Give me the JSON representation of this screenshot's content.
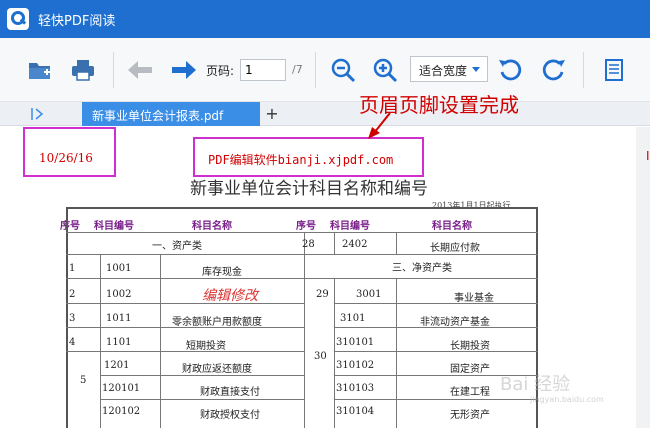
{
  "app": {
    "title": "轻快PDF阅读"
  },
  "toolbar": {
    "page_label": "页码:",
    "page_value": "1",
    "page_total": "/7",
    "zoom_mode": "适合宽度"
  },
  "tabs": [
    {
      "label": "新事业单位会计报表.pdf"
    }
  ],
  "annotation": {
    "callout": "页眉页脚设置完成"
  },
  "document": {
    "header_date": "10/26/16",
    "header_text": "PDF编辑软件bianji.xjpdf.com",
    "title": "新事业单位会计科目名称和编号",
    "effective_date": "2013年1月1日起执行",
    "columns": [
      "序号",
      "科目编号",
      "科目名称",
      "序号",
      "科目编号",
      "科目名称"
    ],
    "rows": {
      "r1": {
        "left_section": "一、资产类",
        "right_no": "28",
        "right_code": "2402",
        "right_name": "长期应付款"
      },
      "r2": {
        "left_no": "1",
        "left_code": "1001",
        "left_name": "库存现金",
        "right_section": "三、净资产类"
      },
      "r3": {
        "left_no": "2",
        "left_code": "1002",
        "left_name": "编辑修改",
        "right_no": "29",
        "right_code": "3001",
        "right_name": "事业基金"
      },
      "r4": {
        "left_no": "3",
        "left_code": "1011",
        "left_name": "零余额账户用款额度",
        "right_code": "3101",
        "right_name": "非流动资产基金"
      },
      "r5": {
        "left_no": "4",
        "left_code": "1101",
        "left_name": "短期投资",
        "right_code": "310101",
        "right_name": "长期投资"
      },
      "r6": {
        "left_no": "5",
        "left_code": "1201",
        "left_name": "财政应返还额度",
        "right_no": "30",
        "right_code": "310102",
        "right_name": "固定资产"
      },
      "r7": {
        "left_code": "120101",
        "left_name": "财政直接支付",
        "right_code": "310103",
        "right_name": "在建工程"
      },
      "r8": {
        "left_code": "120102",
        "left_name": "财政授权支付",
        "right_code": "310104",
        "right_name": "无形资产"
      }
    }
  },
  "watermark": {
    "text": "Bai 经验",
    "sub": "jingyan.baidu.com"
  },
  "colors": {
    "brand": "#1e6fd0",
    "tab_active": "#3a8ee6",
    "annotation": "#d02fd0",
    "header_red": "#d10000"
  },
  "icons": [
    "app-logo-icon",
    "open-folder-icon",
    "print-icon",
    "prev-page-icon",
    "next-page-icon",
    "zoom-out-icon",
    "zoom-in-icon",
    "rotate-left-icon",
    "rotate-right-icon",
    "single-page-icon",
    "sidebar-toggle-icon",
    "add-tab-icon",
    "callout-arrow-icon"
  ]
}
